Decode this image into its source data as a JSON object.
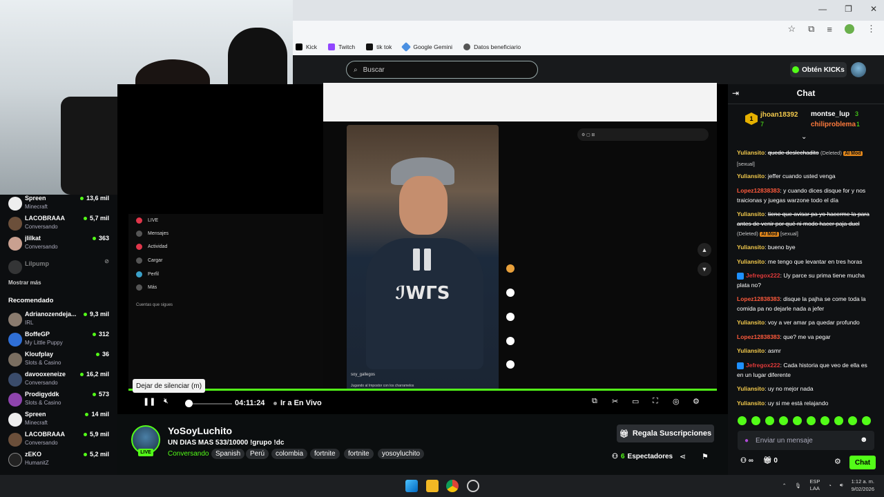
{
  "bookmarks": [
    "Kick",
    "Twitch",
    "tik tok",
    "Google Gemini",
    "Datos beneficiario"
  ],
  "header": {
    "search_placeholder": "Buscar",
    "get_kicks": "Obtén KICKs"
  },
  "sidebar": {
    "following": [
      {
        "name": "Spreen",
        "category": "Minecraft",
        "viewers": "13,6 mil"
      },
      {
        "name": "LACOBRAAA",
        "category": "Conversando",
        "viewers": "5,7 mil"
      },
      {
        "name": "jlilkat",
        "category": "Conversando",
        "viewers": "363"
      },
      {
        "name": "Lilpump",
        "category": "",
        "viewers": ""
      }
    ],
    "show_more": "Mostrar más",
    "recommended_heading": "Recomendado",
    "recommended": [
      {
        "name": "Adrianozendeja...",
        "category": "IRL",
        "viewers": "9,3 mil"
      },
      {
        "name": "BoffeGP",
        "category": "My Little Puppy",
        "viewers": "312"
      },
      {
        "name": "Kloufplay",
        "category": "Slots & Casino",
        "viewers": "36"
      },
      {
        "name": "davooxeneize",
        "category": "Conversando",
        "viewers": "16,2 mil"
      },
      {
        "name": "Prodigyddk",
        "category": "Slots & Casino",
        "viewers": "573"
      },
      {
        "name": "Spreen",
        "category": "Minecraft",
        "viewers": "14 mil"
      },
      {
        "name": "LACOBRAAA",
        "category": "Conversando",
        "viewers": "5,9 mil"
      },
      {
        "name": "zEKO",
        "category": "HumanitZ",
        "viewers": "5,2 mil"
      }
    ]
  },
  "inner_screen": {
    "menu": [
      "LIVE",
      "Mensajes",
      "Actividad",
      "Cargar",
      "Perfil",
      "Más"
    ],
    "following_heading": "Cuentas que sigues",
    "tiktok_user": "soy_gallegos",
    "tiktok_caption": "Jugando al Impostor con los charramelos"
  },
  "player": {
    "tooltip": "Dejar de silenciar (m)",
    "time": "04:11:24",
    "live_link": "Ir a En Vivo",
    "progress": 1.0
  },
  "stream": {
    "streamer": "YoSoyLuchito",
    "live": "LIVE",
    "title": "UN DIAS MAS 533/10000 !grupo !dc",
    "category": "Conversando",
    "tags": [
      "Spanish",
      "Perú",
      "colombia",
      "fortnite",
      "fortnite",
      "yosoyluchito"
    ],
    "gift_button": "Regala Suscripciones",
    "viewers": "6",
    "viewers_label": "Espectadores"
  },
  "chat": {
    "title": "Chat",
    "gifters": [
      {
        "rank": "1",
        "name": "jhoan18392",
        "count": "7"
      },
      {
        "name": "montse_lup",
        "count": "3"
      },
      {
        "name": "chiliproblema",
        "count": "1"
      }
    ],
    "messages": [
      {
        "user": "Yuliansito",
        "text": "quede deslechadito",
        "deleted": "(Deleted)",
        "mod": "AI Mod",
        "tag": "[sexual]"
      },
      {
        "user": "Yuliansito",
        "text": "jeffer cuando usted venga"
      },
      {
        "user": "Lopez12838383",
        "text": "y cuando dices disque for y nos traicionas y juegas warzone todo el día"
      },
      {
        "user": "Yuliansito",
        "text": "tiene que avisar pa yo hacerme la para antes de venir por qué ni modo hacer paja duel",
        "deleted": "(Deleted)",
        "mod": "AI Mod",
        "tag": "[sexual]"
      },
      {
        "user": "Yuliansito",
        "text": "bueno bye"
      },
      {
        "user": "Yuliansito",
        "text": "me tengo que levantar en tres horas"
      },
      {
        "user": "Jefregox222",
        "text": "Uy parce su prima tiene mucha plata no?"
      },
      {
        "user": "Lopez12838383",
        "text": "disque la pajha se come toda la comida pa no dejarle nada a jefer"
      },
      {
        "user": "Yuliansito",
        "text": "voy a ver amar pa quedar profundo"
      },
      {
        "user": "Lopez12838383",
        "text": "que? me va pegar"
      },
      {
        "user": "Yuliansito",
        "text": "asmr"
      },
      {
        "user": "Jefregox222",
        "text": "Cada historia que veo de ella es en un lugar diferente"
      },
      {
        "user": "Yuliansito",
        "text": "uy no mejor nada"
      },
      {
        "user": "Yuliansito",
        "text": "uy si me está relajando"
      }
    ],
    "input_placeholder": "Enviar un mensaje",
    "kicks_count": "0",
    "send": "Chat"
  },
  "taskbar": {
    "lang": "ESP",
    "lang2": "LAA",
    "time": "1:12 a. m.",
    "date": "9/02/2026"
  },
  "colors": {
    "accent": "#53fc18",
    "chat_user_yellow": "#f2c94c",
    "chat_user_orange": "#ff5a3c"
  }
}
